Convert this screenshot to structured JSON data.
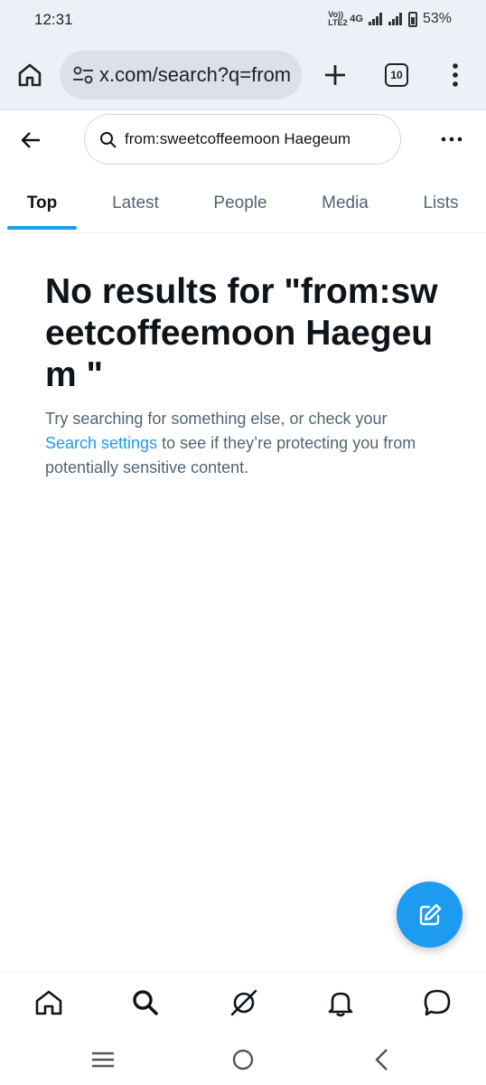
{
  "status": {
    "time": "12:31",
    "volte": "Vo)) LTE2",
    "network": "4G",
    "battery": "53%"
  },
  "browser": {
    "url": "x.com/search?q=from",
    "tab_count": "10"
  },
  "search": {
    "query": "from:sweetcoffeemoon Haegeum"
  },
  "tabs": [
    {
      "label": "Top",
      "active": true
    },
    {
      "label": "Latest",
      "active": false
    },
    {
      "label": "People",
      "active": false
    },
    {
      "label": "Media",
      "active": false
    },
    {
      "label": "Lists",
      "active": false
    }
  ],
  "empty_state": {
    "title": "No results for \"from:sweetcoffeemoon Haegeum \"",
    "body_before": "Try searching for something else, or check your ",
    "link": "Search settings",
    "body_after": " to see if they’re protecting you from potentially sensitive content."
  },
  "colors": {
    "accent": "#1d9bf0",
    "text_primary": "#0f1419",
    "text_secondary": "#536471"
  },
  "icons": {
    "bottom_nav": [
      "home-icon",
      "search-icon",
      "grok-icon",
      "notifications-icon",
      "messages-icon"
    ]
  }
}
